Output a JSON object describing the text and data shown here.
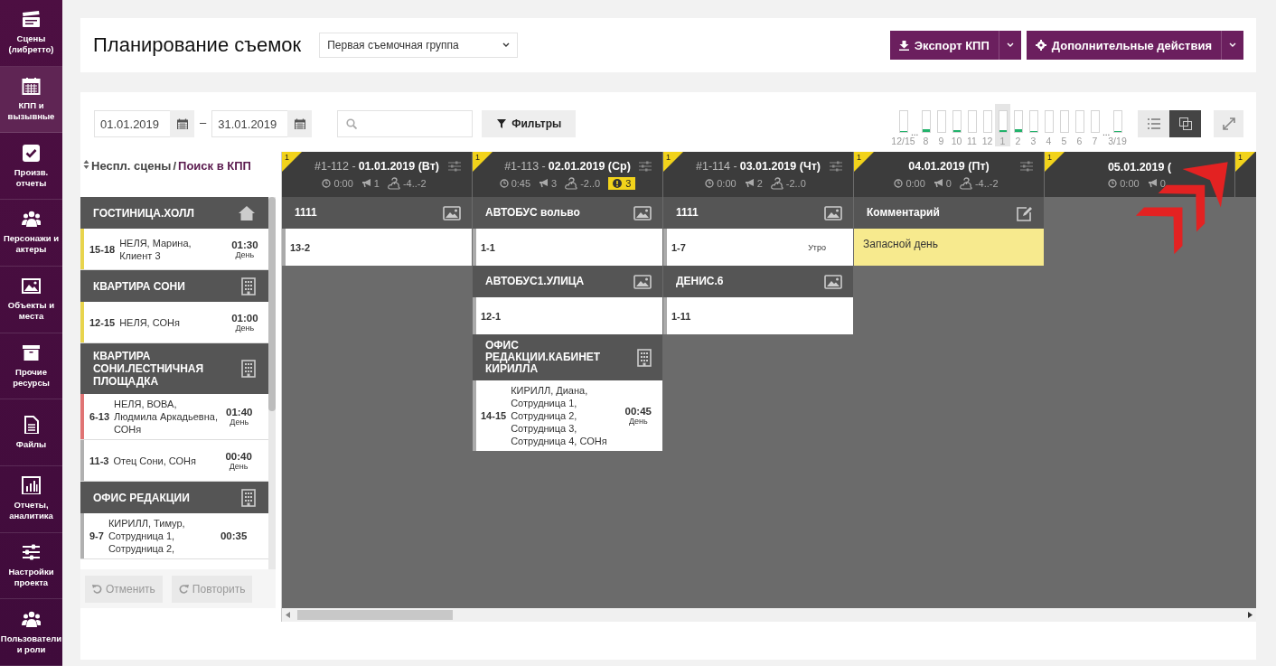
{
  "sidebar": {
    "items": [
      {
        "label": "Сцены (либретто)",
        "selected": false
      },
      {
        "label": "КПП и вызывные",
        "selected": true
      },
      {
        "label": "Произв. отчеты",
        "selected": false
      },
      {
        "label": "Персонажи и актеры",
        "selected": false
      },
      {
        "label": "Объекты и места",
        "selected": false
      },
      {
        "label": "Прочие ресурсы",
        "selected": false
      },
      {
        "label": "Файлы",
        "selected": false
      },
      {
        "label": "Отчеты, аналитика",
        "selected": false
      },
      {
        "label": "Настройки проекта",
        "selected": false
      },
      {
        "label": "Пользователи и роли",
        "selected": false
      }
    ]
  },
  "header": {
    "title": "Планирование съемок",
    "group_select": {
      "value": "Первая съемочная группа"
    },
    "buttons": [
      {
        "label": "Экспорт КПП",
        "kind": "export"
      },
      {
        "label": "Дополнительные действия",
        "kind": "settings"
      }
    ]
  },
  "toolbar": {
    "date_from": "01.01.2019",
    "range_dash": "–",
    "date_to": "31.01.2019",
    "filters_button": "Фильтры",
    "day_strip": [
      {
        "kind": "day",
        "label": "12/15",
        "level": 0.04,
        "selected": false
      },
      {
        "kind": "gap",
        "label": "..."
      },
      {
        "kind": "day",
        "label": "8",
        "level": 0.14,
        "selected": false
      },
      {
        "kind": "day",
        "label": "9",
        "selected": false
      },
      {
        "kind": "day",
        "label": "10",
        "level": 0.08,
        "selected": false
      },
      {
        "kind": "day",
        "label": "11",
        "selected": false
      },
      {
        "kind": "day",
        "label": "12",
        "selected": false
      },
      {
        "kind": "day",
        "label": "1",
        "level": 0.08,
        "selected": true
      },
      {
        "kind": "day",
        "label": "2",
        "level": 0.14,
        "selected": false
      },
      {
        "kind": "day",
        "label": "3",
        "level": 0.04,
        "selected": false
      },
      {
        "kind": "day",
        "label": "4",
        "selected": false
      },
      {
        "kind": "day",
        "label": "5",
        "selected": false
      },
      {
        "kind": "day",
        "label": "6",
        "selected": false
      },
      {
        "kind": "day",
        "label": "7",
        "selected": false
      },
      {
        "kind": "gap",
        "label": "..."
      },
      {
        "kind": "day",
        "label": "3/19",
        "level": 0.04,
        "selected": false
      }
    ],
    "view_modes": [
      {
        "kind": "list",
        "selected": false
      },
      {
        "kind": "cards",
        "selected": true
      }
    ]
  },
  "unscheduled": {
    "sort_label": "Неспл. сцены",
    "separator": "/",
    "search_link": "Поиск в КПП",
    "locations": [
      {
        "name": "ГОСТИНИЦА.ХОЛЛ",
        "kind": "home",
        "scenes": [
          {
            "number": "15-18",
            "cast": "НЕЛЯ, Марина, Клиент 3",
            "duration": "01:30",
            "time_of_day": "День",
            "color": "#e8d44d"
          }
        ]
      },
      {
        "name": "КВАРТИРА СОНИ",
        "kind": "building",
        "scenes": [
          {
            "number": "12-15",
            "cast": "НЕЛЯ, СОНя",
            "duration": "01:00",
            "time_of_day": "День",
            "color": "#e8d44d"
          }
        ]
      },
      {
        "name": "КВАРТИРА СОНИ.ЛЕСТНИЧНАЯ ПЛОЩАДКА",
        "kind": "building",
        "scenes": [
          {
            "number": "6-13",
            "cast": "НЕЛЯ, ВОВА, Людмила Аркадьевна, СОНя",
            "duration": "01:40",
            "time_of_day": "День",
            "color": "#e07474"
          },
          {
            "number": "11-3",
            "cast": "Отец Сони, СОНя",
            "duration": "00:40",
            "time_of_day": "День",
            "color": "#b0b0b0"
          }
        ]
      },
      {
        "name": "ОФИС РЕДАКЦИИ",
        "kind": "building",
        "scenes": [
          {
            "number": "9-7",
            "cast": "КИРИЛЛ, Тимур, Сотрудница 1, Сотрудница 2,",
            "duration": "00:35",
            "color": "#b0b0b0"
          }
        ]
      }
    ],
    "undo_buttons": [
      {
        "label": "Отменить",
        "kind": "undo",
        "disabled": true
      },
      {
        "label": "Повторить",
        "kind": "redo",
        "disabled": true
      }
    ]
  },
  "days": [
    {
      "badge": "1",
      "code": "#1-112 -",
      "date": "01.01.2019 (Вт)",
      "menu": true,
      "time": "0:00",
      "calls": "1",
      "weather": "-4..-2",
      "locations": [
        {
          "name": "1111",
          "kind": "image",
          "scenes": [
            {
              "number": "13-2"
            }
          ]
        }
      ]
    },
    {
      "badge": "1",
      "code": "#1-113 -",
      "date": "02.01.2019 (Ср)",
      "menu": true,
      "time": "0:45",
      "calls": "3",
      "weather": "-2..0",
      "warnings": "3",
      "locations": [
        {
          "name": "АВТОБУС вольво",
          "kind": "image",
          "scenes": [
            {
              "number": "1-1"
            }
          ]
        },
        {
          "name": "АВТОБУС1.УЛИЦА",
          "kind": "image",
          "scenes": [
            {
              "number": "12-1"
            }
          ]
        },
        {
          "name": "ОФИС РЕДАКЦИИ.КАБИНЕТ КИРИЛЛА",
          "kind": "building",
          "scenes": [
            {
              "number": "14-15",
              "cast": "КИРИЛЛ, Диана, Сотрудница 1, Сотрудница 2, Сотрудница 3, Сотрудница 4, СОНя",
              "duration": "00:45",
              "time_of_day": "День"
            }
          ]
        }
      ]
    },
    {
      "badge": "1",
      "code": "#1-114 -",
      "date": "03.01.2019 (Чт)",
      "menu": true,
      "time": "0:00",
      "calls": "2",
      "weather": "-2..0",
      "locations": [
        {
          "name": "1111",
          "kind": "image",
          "scenes": [
            {
              "number": "1-7",
              "time_of_day": "Утро"
            }
          ]
        },
        {
          "name": "ДЕНИС.6",
          "kind": "image",
          "scenes": [
            {
              "number": "1-11"
            }
          ]
        }
      ]
    },
    {
      "badge": "1",
      "date": "04.01.2019 (Пт)",
      "menu": true,
      "time": "0:00",
      "calls": "0",
      "weather": "-4..-2",
      "locations": [
        {
          "name": "Комментарий",
          "kind": "comment",
          "note": "Запасной день"
        }
      ]
    },
    {
      "badge": "1",
      "date": "05.01.2019 (",
      "time": "0:00",
      "calls": "0"
    },
    {
      "badge": "1"
    }
  ],
  "annotations": [
    {
      "kind": "arrow"
    }
  ]
}
